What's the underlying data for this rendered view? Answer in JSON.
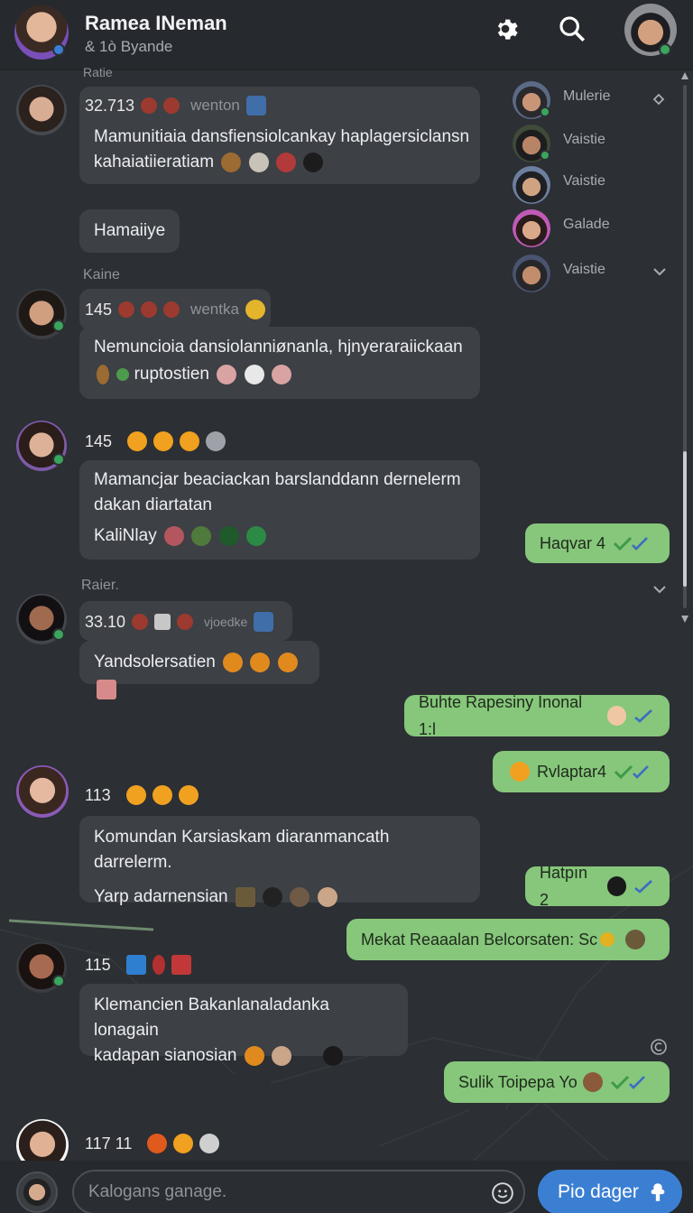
{
  "header": {
    "title": "Ramea INeman",
    "subtitle": "& 1ò Byande",
    "settings_icon": "gear-icon",
    "search_icon": "search-icon"
  },
  "side_list": [
    {
      "name": "Mulerie"
    },
    {
      "name": "Vaistie"
    },
    {
      "name": "Vaistie"
    },
    {
      "name": "Galade"
    },
    {
      "name": "Vaistie"
    }
  ],
  "labels": {
    "top_cut": "Ratie",
    "kaine": "Kaine",
    "raier": "Raier."
  },
  "messages": [
    {
      "meta": "32.713",
      "extra": "wenton",
      "lines": [
        "Mamunitiaia dansfiensiolcankay haplagersiclansn",
        "kahaiatiieratiam"
      ]
    },
    {
      "meta": "",
      "extra": "",
      "lines": [
        "Hamaiiye"
      ]
    },
    {
      "meta": "145",
      "extra": "wentka",
      "lines": [
        "Nemuncioia dansiolanniønanla, hjnyeraraiickaan",
        "ruptostien"
      ]
    },
    {
      "meta": "145",
      "extra": "",
      "lines": [
        "Mamancjar beaciackan barslanddann dernelerm",
        "dakan diartatan",
        "KaliNlay"
      ]
    },
    {
      "meta": "33.10",
      "extra": "vjoedke",
      "lines": [
        "Yandsolersatien"
      ]
    },
    {
      "meta": "113",
      "extra": "",
      "lines": [
        "Komundan Karsiaskam diaranmancath darrelerm.",
        "Yarp adarnensian"
      ]
    },
    {
      "meta": "115",
      "extra": "",
      "lines": [
        "Klemancien Bakanlanaladanka lonagain",
        "kadapan sianosian"
      ]
    },
    {
      "meta": "117 11",
      "extra": "",
      "lines": []
    }
  ],
  "outgoing": [
    {
      "text": "Haqvar 4"
    },
    {
      "text": "Buhte Rapesiny Inonal 1:l"
    },
    {
      "text": "Rvlaptar4"
    },
    {
      "text": "Hatpın 2"
    },
    {
      "text": "Mekat Reaaalan Belcorsaten: Sc"
    },
    {
      "text": "Sulik Toipepa Yo"
    }
  ],
  "composer": {
    "placeholder": "Kalogans ganage.",
    "send_label": "Pio dager"
  },
  "colors": {
    "background": "#2c2f33",
    "bubble_in": "#3d4045",
    "bubble_out": "#86c77b",
    "accent": "#3b7fd3",
    "online": "#3aa55c"
  }
}
